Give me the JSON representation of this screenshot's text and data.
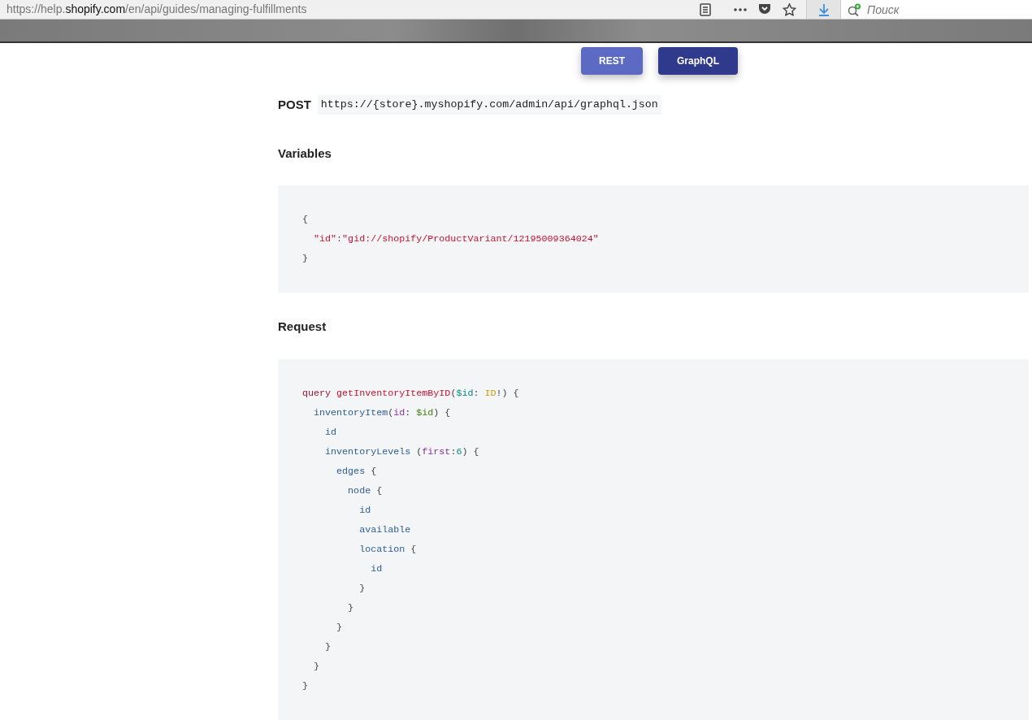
{
  "browser": {
    "url_host_prefix": "https://help.",
    "url_domain": "shopify.com",
    "url_path": "/en/api/guides/managing-fulfillments",
    "search": {
      "placeholder": "Поиск"
    }
  },
  "tabs": [
    {
      "label": "REST",
      "selected": false
    },
    {
      "label": "GraphQL",
      "selected": true
    }
  ],
  "endpoint": {
    "method": "POST",
    "url": "https://{store}.myshopify.com/admin/api/graphql.json"
  },
  "sections": [
    {
      "heading": "Variables",
      "lines": [
        [
          {
            "text": "{",
            "kind": "punct"
          }
        ],
        [
          {
            "text": "  \"id\"",
            "kind": "string"
          },
          {
            "text": ":",
            "kind": "punct"
          },
          {
            "text": "\"gid://shopify/ProductVariant/12195009364024\"",
            "kind": "string"
          }
        ],
        [
          {
            "text": "}",
            "kind": "punct"
          }
        ]
      ]
    },
    {
      "heading": "Request",
      "lines": [
        [
          {
            "text": "query ",
            "kind": "keyword"
          },
          {
            "text": "getInventoryItemByID",
            "kind": "name"
          },
          {
            "text": "(",
            "kind": "punct"
          },
          {
            "text": "$id",
            "kind": "variable"
          },
          {
            "text": ": ",
            "kind": "punct"
          },
          {
            "text": "ID",
            "kind": "type"
          },
          {
            "text": "!) {",
            "kind": "punct"
          }
        ],
        [
          {
            "text": "  inventoryItem",
            "kind": "field"
          },
          {
            "text": "(",
            "kind": "punct"
          },
          {
            "text": "id",
            "kind": "argument"
          },
          {
            "text": ": ",
            "kind": "punct"
          },
          {
            "text": "$id",
            "kind": "value"
          },
          {
            "text": ") {",
            "kind": "punct"
          }
        ],
        [
          {
            "text": "    id",
            "kind": "field"
          }
        ],
        [
          {
            "text": "    inventoryLevels",
            "kind": "field"
          },
          {
            "text": " (",
            "kind": "punct"
          },
          {
            "text": "first",
            "kind": "argument"
          },
          {
            "text": ":",
            "kind": "punct"
          },
          {
            "text": "6",
            "kind": "number"
          },
          {
            "text": ") {",
            "kind": "punct"
          }
        ],
        [
          {
            "text": "      edges",
            "kind": "field"
          },
          {
            "text": " {",
            "kind": "punct"
          }
        ],
        [
          {
            "text": "        node",
            "kind": "field"
          },
          {
            "text": " {",
            "kind": "punct"
          }
        ],
        [
          {
            "text": "          id",
            "kind": "field"
          }
        ],
        [
          {
            "text": "          available",
            "kind": "field"
          }
        ],
        [
          {
            "text": "          location",
            "kind": "field"
          },
          {
            "text": " {",
            "kind": "punct"
          }
        ],
        [
          {
            "text": "            id",
            "kind": "field"
          }
        ],
        [
          {
            "text": "          }",
            "kind": "punct"
          }
        ],
        [
          {
            "text": "        }",
            "kind": "punct"
          }
        ],
        [
          {
            "text": "      }",
            "kind": "punct"
          }
        ],
        [
          {
            "text": "    }",
            "kind": "punct"
          }
        ],
        [
          {
            "text": "  }",
            "kind": "punct"
          }
        ],
        [
          {
            "text": "}",
            "kind": "punct"
          }
        ]
      ]
    }
  ]
}
